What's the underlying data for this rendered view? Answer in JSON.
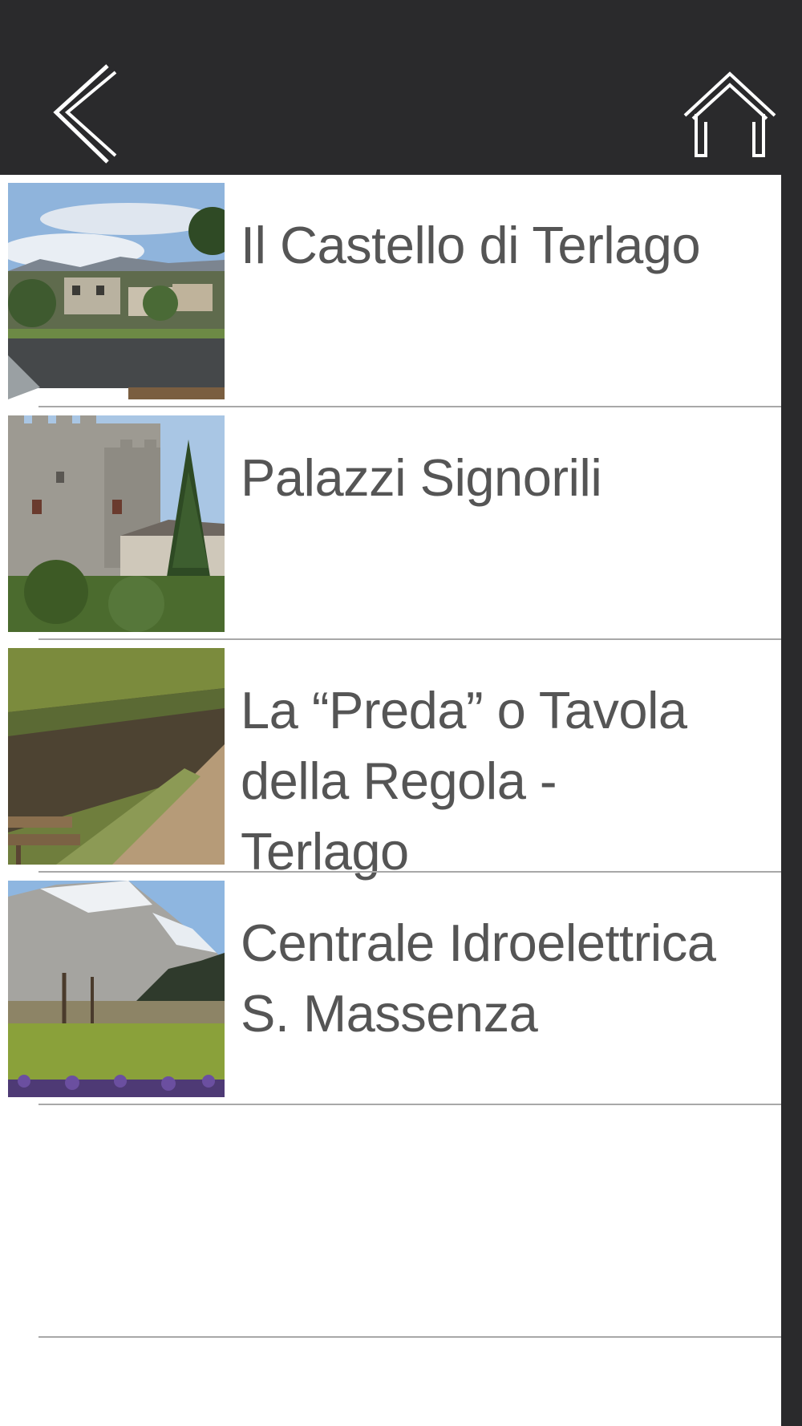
{
  "header": {
    "back_icon": "chevron-left-icon",
    "home_icon": "home-outline-icon"
  },
  "items": [
    {
      "title": "Il Castello di Terlago",
      "thumb": "castle-village-photo"
    },
    {
      "title": "Palazzi Signorili",
      "thumb": "stone-tower-palace-photo"
    },
    {
      "title": "La “Preda” o Tavola\ndella Regola -\nTerlago",
      "thumb": "stone-wall-path-photo"
    },
    {
      "title": "Centrale Idroelettrica\nS. Massenza",
      "thumb": "mountain-meadow-photo"
    }
  ],
  "colors": {
    "header_bg": "#2a2a2c",
    "list_bg": "#ffffff",
    "title_text": "#555555",
    "divider": "#a8a8a8"
  }
}
